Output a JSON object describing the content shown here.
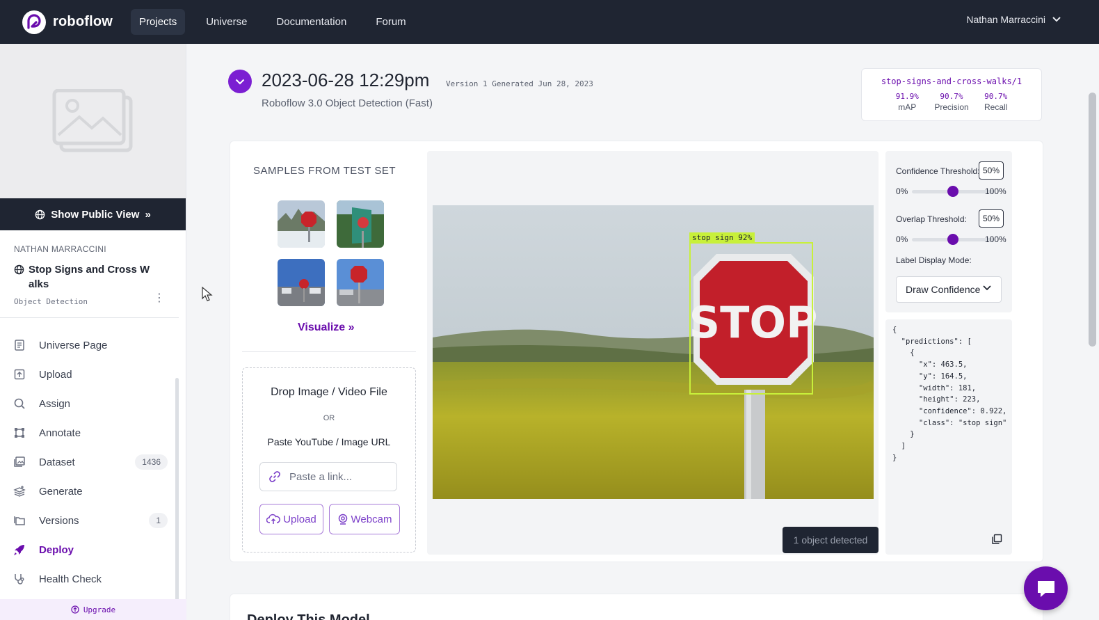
{
  "nav": {
    "brand": "roboflow",
    "items": [
      {
        "label": "Projects",
        "active": true
      },
      {
        "label": "Universe",
        "active": false
      },
      {
        "label": "Documentation",
        "active": false
      },
      {
        "label": "Forum",
        "active": false
      }
    ],
    "user": "Nathan Marraccini"
  },
  "sidebar": {
    "public_view": "Show Public View",
    "owner": "NATHAN MARRACCINI",
    "project_name": "Stop Signs and Cross W alks",
    "project_type": "Object Detection",
    "items": [
      {
        "label": "Universe Page",
        "icon": "document-icon",
        "badge": ""
      },
      {
        "label": "Upload",
        "icon": "upload-icon",
        "badge": ""
      },
      {
        "label": "Assign",
        "icon": "search-icon",
        "badge": ""
      },
      {
        "label": "Annotate",
        "icon": "annotate-icon",
        "badge": ""
      },
      {
        "label": "Dataset",
        "icon": "images-icon",
        "badge": "1436"
      },
      {
        "label": "Generate",
        "icon": "layers-icon",
        "badge": ""
      },
      {
        "label": "Versions",
        "icon": "folders-icon",
        "badge": "1"
      },
      {
        "label": "Deploy",
        "icon": "rocket-icon",
        "badge": "",
        "active": true
      },
      {
        "label": "Health Check",
        "icon": "stethoscope-icon",
        "badge": ""
      }
    ],
    "upgrade": "Upgrade"
  },
  "version": {
    "title": "2023-06-28 12:29pm",
    "meta": "Version 1 Generated Jun 28, 2023",
    "subtitle": "Roboflow 3.0 Object Detection (Fast)"
  },
  "metrics": {
    "slug": "stop-signs-and-cross-walks/1",
    "items": [
      {
        "value": "91.9%",
        "label": "mAP"
      },
      {
        "value": "90.7%",
        "label": "Precision"
      },
      {
        "value": "90.7%",
        "label": "Recall"
      }
    ]
  },
  "samples": {
    "title": "SAMPLES FROM TEST SET",
    "visualize": "Visualize"
  },
  "dropzone": {
    "title": "Drop Image / Video File",
    "or": "OR",
    "paste": "Paste YouTube / Image URL",
    "placeholder": "Paste a link...",
    "upload": "Upload",
    "webcam": "Webcam"
  },
  "inference": {
    "bbox_label": "stop sign 92%",
    "sign_text": "STOP",
    "detected": "1 object detected"
  },
  "controls": {
    "confidence_label": "Confidence Threshold:",
    "confidence_value": "50%",
    "confidence_fraction": 0.5,
    "overlap_label": "Overlap Threshold:",
    "overlap_value": "50%",
    "overlap_fraction": 0.5,
    "min": "0%",
    "max": "100%",
    "label_mode_label": "Label Display Mode:",
    "label_mode_value": "Draw Confidence"
  },
  "json_output": "{\n  \"predictions\": [\n    {\n      \"x\": 463.5,\n      \"y\": 164.5,\n      \"width\": 181,\n      \"height\": 223,\n      \"confidence\": 0.922,\n      \"class\": \"stop sign\"\n    }\n  ]\n}",
  "deploy": {
    "title": "Deploy This Model"
  },
  "colors": {
    "brand_purple": "#6a0dad",
    "nav_dark": "#1f2532",
    "bbox": "#c8f03a"
  }
}
